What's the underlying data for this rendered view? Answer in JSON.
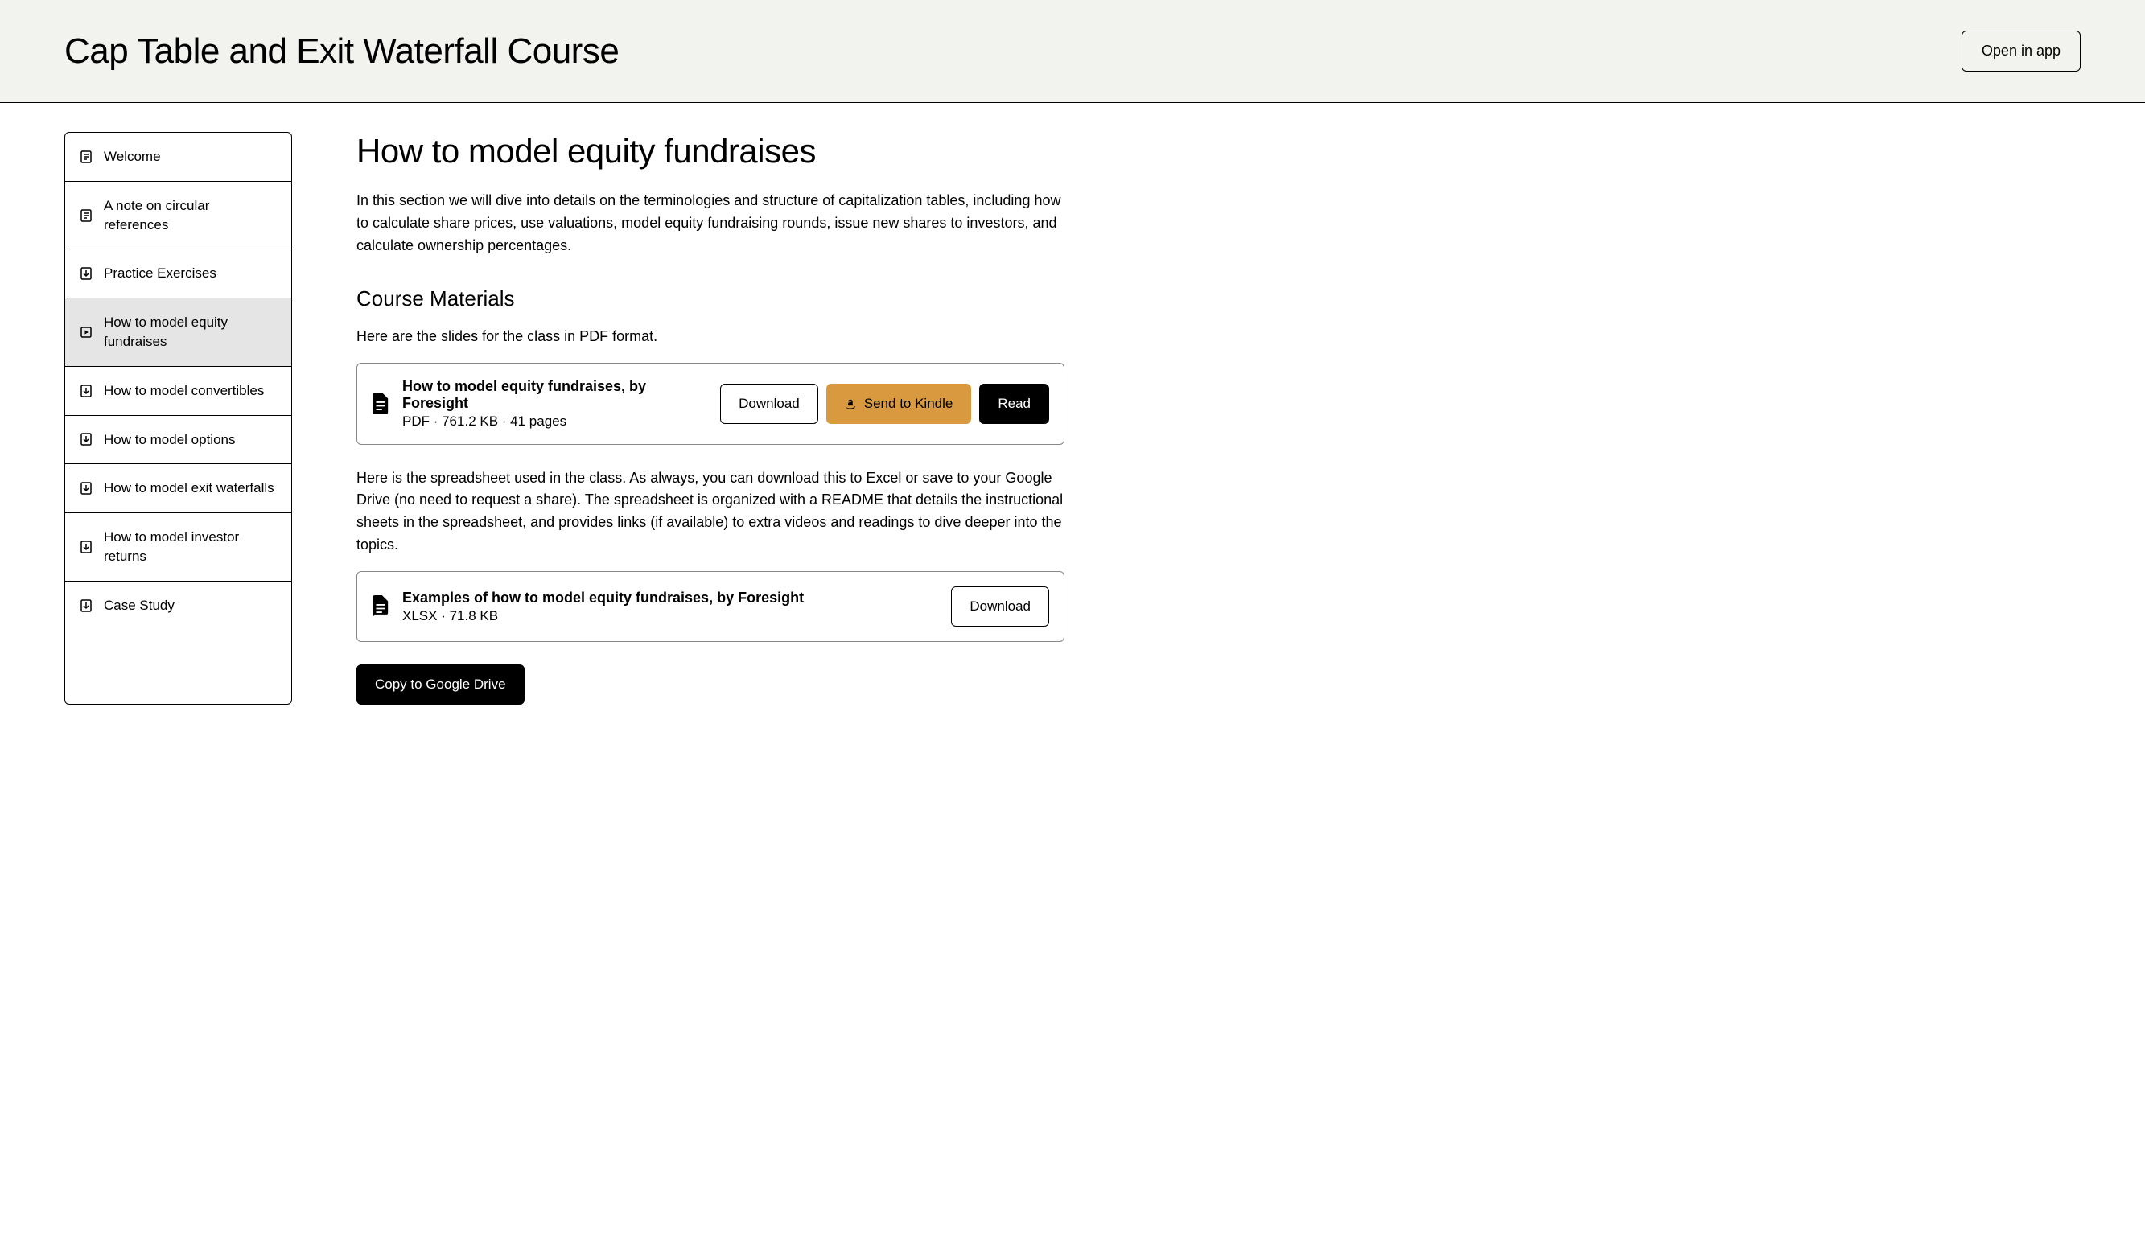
{
  "header": {
    "title": "Cap Table and Exit Waterfall Course",
    "open_app_label": "Open in app"
  },
  "sidebar": {
    "items": [
      {
        "icon": "document",
        "label": "Welcome"
      },
      {
        "icon": "document",
        "label": "A note on circular references"
      },
      {
        "icon": "download",
        "label": "Practice Exercises"
      },
      {
        "icon": "play",
        "label": "How to model equity fundraises"
      },
      {
        "icon": "download",
        "label": "How to model convertibles"
      },
      {
        "icon": "download",
        "label": "How to model options"
      },
      {
        "icon": "download",
        "label": "How to model exit waterfalls"
      },
      {
        "icon": "download",
        "label": "How to model investor returns"
      },
      {
        "icon": "download",
        "label": "Case Study"
      }
    ],
    "active_index": 3
  },
  "main": {
    "title": "How to model equity fundraises",
    "intro": "In this section we will dive into details on the terminologies and structure of capitalization tables, including how to calculate share prices, use valuations, model equity fundraising rounds, issue new shares to investors, and calculate ownership percentages.",
    "materials_heading": "Course Materials",
    "materials_intro": "Here are the slides for the class in PDF format.",
    "material1": {
      "title": "How to model equity fundraises, by Foresight",
      "meta": "PDF · 761.2 KB · 41 pages",
      "download_label": "Download",
      "kindle_label": "Send to Kindle",
      "read_label": "Read"
    },
    "spreadsheet_intro": "Here is the spreadsheet used in the class. As always, you can download this to Excel or save to your Google Drive (no need to request a share). The spreadsheet is organized with a README that details the instructional sheets in the spreadsheet, and provides links (if available) to extra videos and readings to dive deeper into the topics.",
    "material2": {
      "title": "Examples of how to model equity fundraises, by Foresight",
      "meta": "XLSX · 71.8 KB",
      "download_label": "Download"
    },
    "copy_drive_label": "Copy to Google Drive"
  }
}
